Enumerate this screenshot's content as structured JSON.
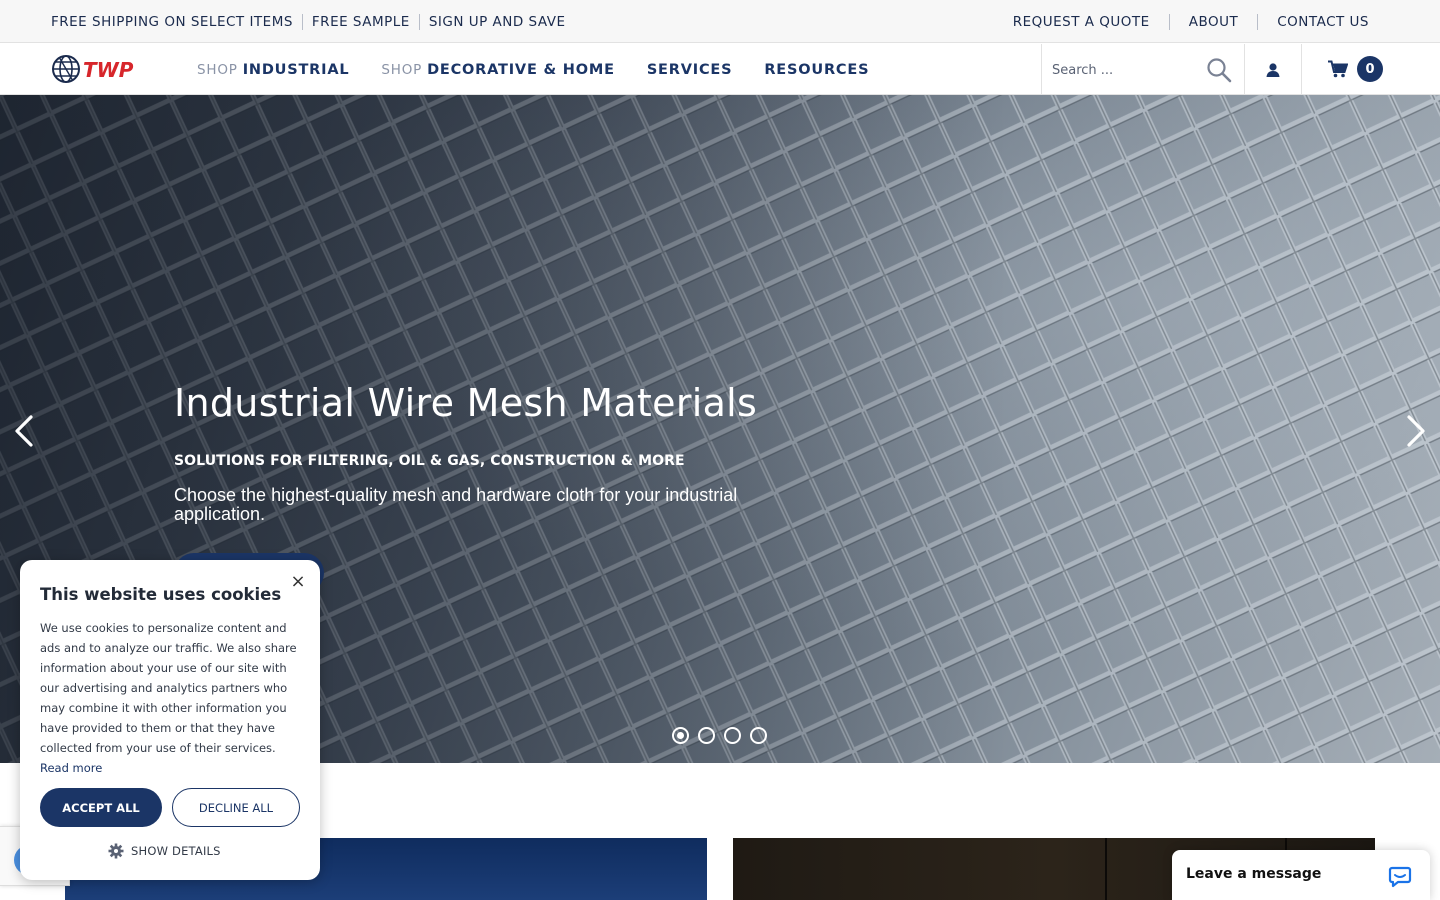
{
  "topbar": {
    "left_links": [
      "FREE SHIPPING ON SELECT ITEMS",
      "FREE SAMPLE",
      "SIGN UP AND SAVE"
    ],
    "right_links": [
      "REQUEST A QUOTE",
      "ABOUT",
      "CONTACT US"
    ]
  },
  "nav": {
    "logo_text": "TWP",
    "items": [
      {
        "prefix": "SHOP",
        "label": "INDUSTRIAL"
      },
      {
        "prefix": "SHOP",
        "label": "DECORATIVE & HOME"
      },
      {
        "prefix": "",
        "label": "SERVICES"
      },
      {
        "prefix": "",
        "label": "RESOURCES"
      }
    ],
    "search_placeholder": "Search ...",
    "cart_count": "0"
  },
  "hero": {
    "title": "Industrial Wire Mesh Materials",
    "subtitle": "SOLUTIONS FOR FILTERING, OIL & GAS, CONSTRUCTION & MORE",
    "description": "Choose the highest-quality mesh and hardware cloth for your industrial application.",
    "slides": 4,
    "active_slide": 1
  },
  "cookie": {
    "title": "This website uses cookies",
    "body": "We use cookies to personalize content and ads and to analyze our traffic. We also share information about your use of our site with our advertising and analytics partners who may combine it with other information you have provided to them or that they have collected from your use of their services.",
    "read_more": "Read more",
    "accept": "ACCEPT ALL",
    "decline": "DECLINE ALL",
    "details": "SHOW DETAILS",
    "close": "×"
  },
  "chat": {
    "label": "Leave a message"
  },
  "colors": {
    "brand_navy": "#1b3566",
    "logo_red": "#d7262b"
  },
  "icons": [
    "globe-logo-icon",
    "search-icon",
    "user-icon",
    "cart-icon",
    "chevron-left-icon",
    "chevron-right-icon",
    "close-icon",
    "gear-icon",
    "chat-bubble-icon"
  ]
}
